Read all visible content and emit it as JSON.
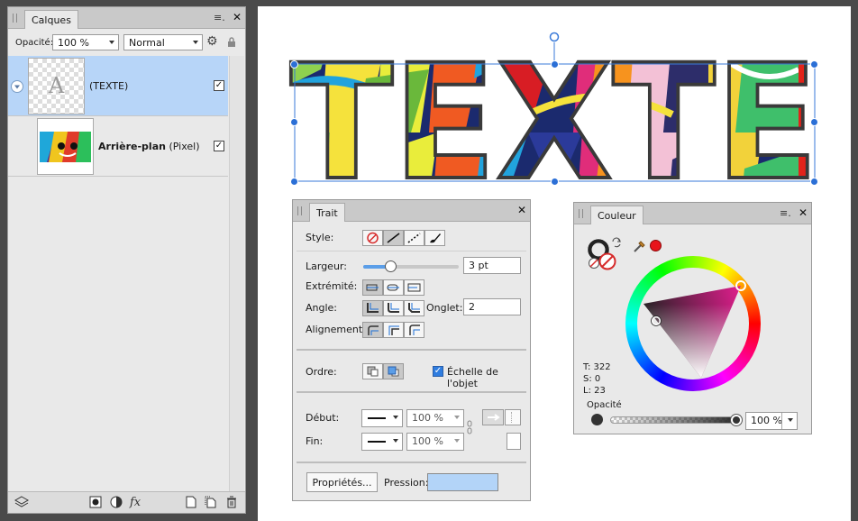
{
  "layers_panel": {
    "tab": "Calques",
    "opacity_label": "Opacité:",
    "opacity_value": "100 %",
    "blend_mode": "Normal",
    "layers": [
      {
        "name": "(TEXTE)",
        "thumb_letter": "A",
        "checked": "✓"
      },
      {
        "name": "Arrière-plan",
        "type": "(Pixel)",
        "checked": "✓"
      }
    ],
    "icons": [
      "stack-icon",
      "mask-icon",
      "adjustment-icon",
      "fx-icon",
      "new-layer-icon",
      "duplicate-icon",
      "trash-icon"
    ],
    "fx": "fx"
  },
  "canvas": {
    "text": "TEXTE"
  },
  "stroke_panel": {
    "tab": "Trait",
    "style_label": "Style:",
    "width_label": "Largeur:",
    "width_value": "3 pt",
    "width_fraction": 0.28,
    "cap_label": "Extrémité:",
    "join_label": "Angle:",
    "miter_label": "Onglet:",
    "miter_value": "2",
    "align_label": "Alignement:",
    "order_label": "Ordre:",
    "scale_label": "Échelle de l'objet",
    "scale_checked": "✓",
    "start_label": "Début:",
    "start_value": "100 %",
    "end_label": "Fin:",
    "end_value": "100 %",
    "properties_button": "Propriétés...",
    "pressure_label": "Pression:"
  },
  "color_panel": {
    "tab": "Couleur",
    "h": "T: 322",
    "s": "S: 0",
    "l": "L: 23",
    "opacity_label": "Opacité",
    "opacity_value": "100 %",
    "swatch_red": "#e8141b",
    "wheel_hue": "#e21d8e"
  }
}
